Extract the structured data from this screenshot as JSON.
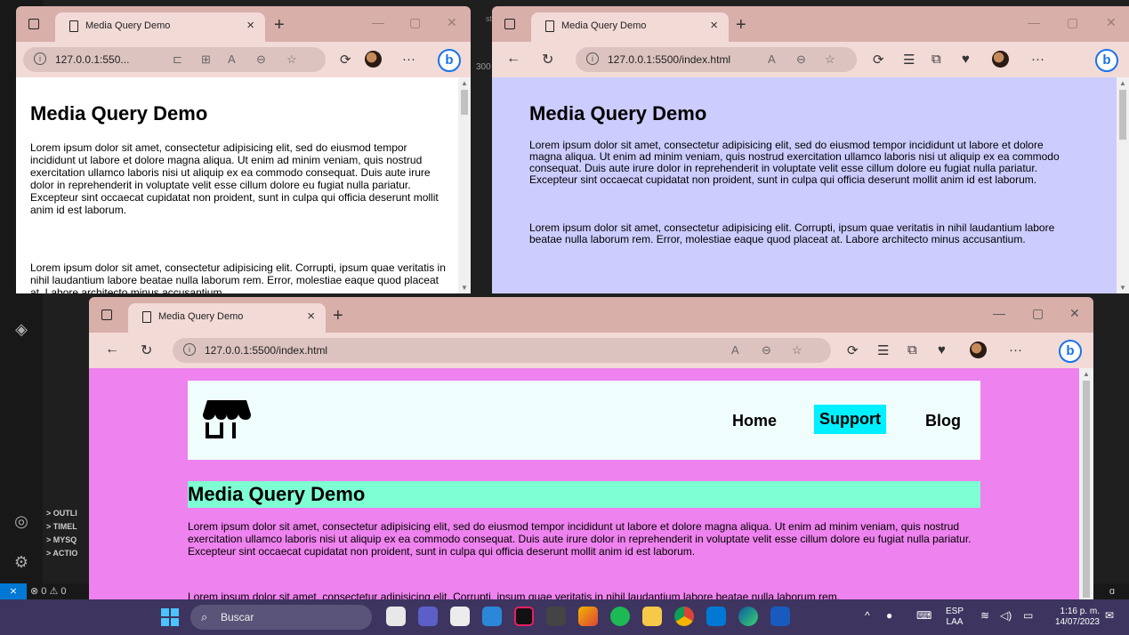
{
  "windows": {
    "top_left": {
      "tab_title": "Media Query Demo",
      "url": "127.0.0.1:550...",
      "heading": "Media Query Demo",
      "paragraph1": "Lorem ipsum dolor sit amet, consectetur adipisicing elit, sed do eiusmod tempor incididunt ut labore et dolore magna aliqua. Ut enim ad minim veniam, quis nostrud exercitation ullamco laboris nisi ut aliquip ex ea commodo consequat. Duis aute irure dolor in reprehenderit in voluptate velit esse cillum dolore eu fugiat nulla pariatur. Excepteur sint occaecat cupidatat non proident, sunt in culpa qui officia deserunt mollit anim id est laborum.",
      "paragraph2": "Lorem ipsum dolor sit amet, consectetur adipisicing elit. Corrupti, ipsum quae veritatis in nihil laudantium labore beatae nulla laborum rem. Error, molestiae eaque quod placeat at. Labore architecto minus accusantium.",
      "bg_color": "#ffffff"
    },
    "top_right": {
      "tab_title": "Media Query Demo",
      "url": "127.0.0.1:5500/index.html",
      "heading": "Media Query Demo",
      "paragraph1": "Lorem ipsum dolor sit amet, consectetur adipisicing elit, sed do eiusmod tempor incididunt ut labore et dolore magna aliqua. Ut enim ad minim veniam, quis nostrud exercitation ullamco laboris nisi ut aliquip ex ea commodo consequat. Duis aute irure dolor in reprehenderit in voluptate velit esse cillum dolore eu fugiat nulla pariatur. Excepteur sint occaecat cupidatat non proident, sunt in culpa qui officia deserunt mollit anim id est laborum.",
      "paragraph2": "Lorem ipsum dolor sit amet, consectetur adipisicing elit. Corrupti, ipsum quae veritatis in nihil laudantium labore beatae nulla laborum rem. Error, molestiae eaque quod placeat at. Labore architecto minus accusantium.",
      "bg_color": "#ccccff"
    },
    "bottom": {
      "tab_title": "Media Query Demo",
      "url": "127.0.0.1:5500/index.html",
      "nav": [
        "Home",
        "Support",
        "Blog"
      ],
      "active_nav": "Support",
      "heading": "Media Query Demo",
      "paragraph1": "Lorem ipsum dolor sit amet, consectetur adipisicing elit, sed do eiusmod tempor incididunt ut labore et dolore magna aliqua. Ut enim ad minim veniam, quis nostrud exercitation ullamco laboris nisi ut aliquip ex ea commodo consequat. Duis aute irure dolor in reprehenderit in voluptate velit esse cillum dolore eu fugiat nulla pariatur. Excepteur sint occaecat cupidatat non proident, sunt in culpa qui officia deserunt mollit anim id est laborum.",
      "paragraph2": "Lorem ipsum dolor sit amet, consectetur adipisicing elit. Corrupti, ipsum quae veritatis in nihil laudantium labore beatae nulla laborum rem.",
      "bg_color": "#ee82ee",
      "heading_bg": "#7fffd4",
      "active_nav_bg": "#00f0ff"
    }
  },
  "vscode": {
    "panel_items": [
      "> OUTLI",
      "> TIMEL",
      "> MYSQ",
      "> ACTIO"
    ],
    "problems": "⊗ 0 ⚠ 0",
    "gutter_number": "300"
  },
  "taskbar": {
    "search_label": "Buscar",
    "lang_top": "ESP",
    "lang_bottom": "LAA",
    "time": "1:16 p. m.",
    "date": "14/07/2023"
  }
}
